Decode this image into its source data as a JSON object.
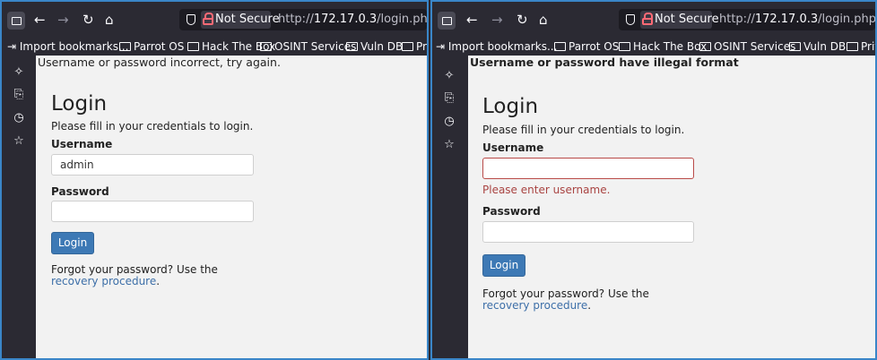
{
  "browser": {
    "security_label": "Not Secure",
    "url_prefix": "http://",
    "url_host": "172.17.0.3",
    "url_path": "/login.php",
    "nav_back": "←",
    "nav_forward": "→",
    "nav_reload": "↻",
    "nav_home": "⌂"
  },
  "bookmarks": {
    "import": "Import bookmarks...",
    "items": [
      "Parrot OS",
      "Hack The Box",
      "OSINT Services",
      "Vuln DB",
      "Priv"
    ]
  },
  "left": {
    "message": "Username or password incorrect, try again.",
    "username_value": "admin",
    "password_value": ""
  },
  "right": {
    "message": "Username or password have illegal format",
    "username_value": "",
    "username_error": "Please enter username.",
    "password_value": ""
  },
  "form": {
    "title": "Login",
    "instructions": "Please fill in your credentials to login.",
    "username_label": "Username",
    "password_label": "Password",
    "login_button": "Login",
    "forgot_text": "Forgot your password? Use the ",
    "forgot_link": "recovery",
    "forgot_link2": "procedure",
    "forgot_end": "."
  },
  "colors": {
    "accent": "#3a86c8",
    "button": "#3d79b5",
    "error": "#a94442",
    "not_secure": "#ff6a75"
  }
}
